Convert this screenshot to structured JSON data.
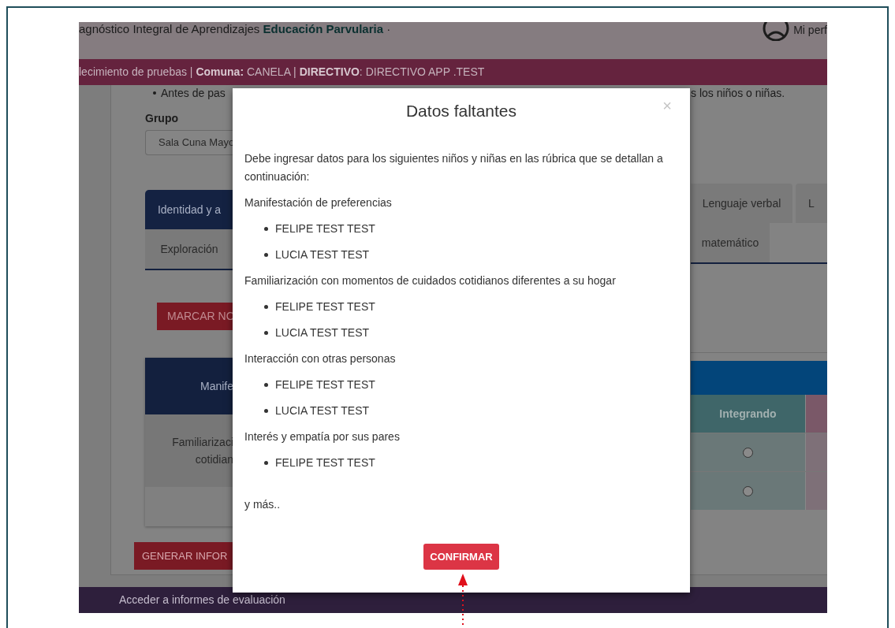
{
  "header": {
    "title": "agnóstico Integral de Aprendizajes **Educación Parvularia** ·",
    "profile": "Mi perf"
  },
  "info_bar": "lecimiento de pruebas | **Comuna:** CANELA | **DIRECTIVO**: DIRECTIVO APP .TEST",
  "notice": {
    "left": "Antes de pas",
    "right": "s los niños o niñas."
  },
  "group": {
    "label": "Grupo",
    "value": "Sala Cuna Mayo"
  },
  "tab_rows": [
    [
      {
        "label": "Identidad y a",
        "selected": true
      },
      {
        "label": "Lenguaje verbal",
        "selected": false
      },
      {
        "label": "L",
        "selected": false
      }
    ],
    [
      {
        "label": "Exploración",
        "selected": false
      },
      {
        "label": "matemático",
        "selected": false
      }
    ]
  ],
  "mark_button": "MARCAR NO",
  "table": {
    "header": "Manife",
    "column": "Integrando",
    "rows": [
      {
        "label_lines": [
          "Familiarizaci",
          "cotidian"
        ],
        "checked": false
      },
      {
        "label_lines": [],
        "checked": false
      }
    ]
  },
  "report_button": "GENERAR INFOR",
  "reports_bar": "Acceder a informes de evaluación",
  "modal": {
    "title": "Datos faltantes",
    "close": "×",
    "intro": "Debe ingresar datos para los siguientes niños y niñas en las rúbrica que se detallan a continuación:",
    "sections": [
      {
        "title": "Manifestación de preferencias",
        "students": [
          "FELIPE TEST TEST",
          "LUCIA TEST TEST"
        ]
      },
      {
        "title": "Familiarización con momentos de cuidados cotidianos diferentes a su hogar",
        "students": [
          "FELIPE TEST TEST",
          "LUCIA TEST TEST"
        ]
      },
      {
        "title": "Interacción con otras personas",
        "students": [
          "FELIPE TEST TEST",
          "LUCIA TEST TEST"
        ]
      },
      {
        "title": "Interés y empatía por sus pares",
        "students": [
          "FELIPE TEST TEST"
        ]
      }
    ],
    "more": "y más..",
    "confirm": "CONFIRMAR"
  }
}
